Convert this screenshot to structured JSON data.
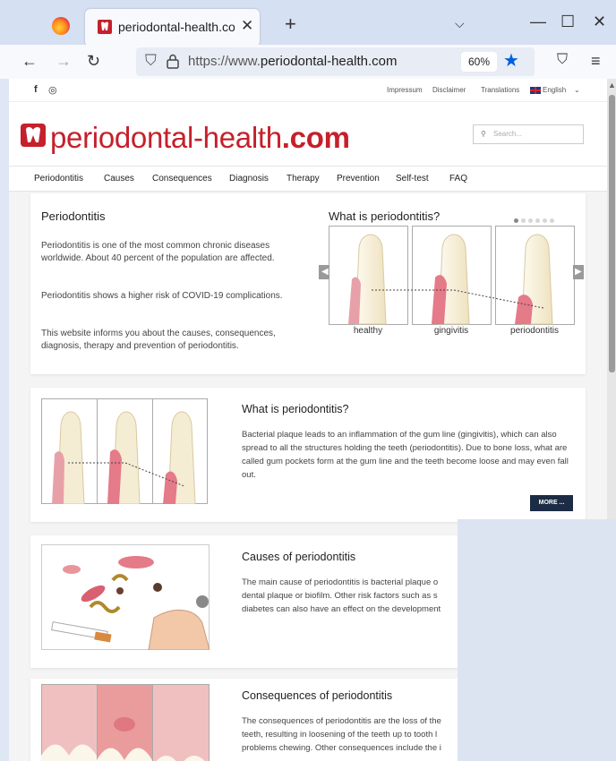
{
  "browser": {
    "tab_title": "periodontal-health.com - Cause",
    "url_prefix": "https://www.",
    "url_domain": "periodontal-health.com",
    "zoom": "60%"
  },
  "site": {
    "topbar_links": [
      "Impressum",
      "Disclaimer",
      "Translations",
      "English"
    ],
    "logo_main": "periodontal-health",
    "logo_suffix": ".com",
    "search_placeholder": "Search...",
    "menu": [
      "Periodontitis",
      "Causes",
      "Consequences",
      "Diagnosis",
      "Therapy",
      "Prevention",
      "Self-test",
      "FAQ"
    ]
  },
  "hero": {
    "title": "Periodontitis",
    "p1": "Periodontitis is one of the most common chronic diseases worldwide. About 40 percent of the population are affected.",
    "p2": "Periodontitis shows a higher risk of COVID-19 complications.",
    "p3": "This website informs you about the causes, consequences, diagnosis, therapy and prevention of periodontitis.",
    "slider_title": "What is periodontitis?",
    "captions": [
      "healthy",
      "gingivitis",
      "periodontitis"
    ]
  },
  "sections": [
    {
      "title": "What is periodontitis?",
      "text": "Bacterial plaque leads to an inflammation of the gum line (gingivitis), which can also spread to all the structures holding the teeth (periodontitis). Due to bone loss, what are called gum pockets form at the gum line and the teeth become loose and may even fall out.",
      "button": "MORE ..."
    },
    {
      "title": "Causes of periodontitis",
      "text": "The main cause of periodontitis is bacterial plaque o dental plaque or biofilm. Other risk factors such as s diabetes can also have an effect on the development"
    },
    {
      "title": "Consequences of periodontitis",
      "text": "The consequences of periodontitis are the loss of the teeth, resulting in loosening of the teeth up to tooth l problems chewing. Other consequences include the i"
    }
  ],
  "colors": {
    "brand_red": "#c5202b",
    "button_navy": "#1d2c45",
    "bookmark_blue": "#0060df"
  }
}
